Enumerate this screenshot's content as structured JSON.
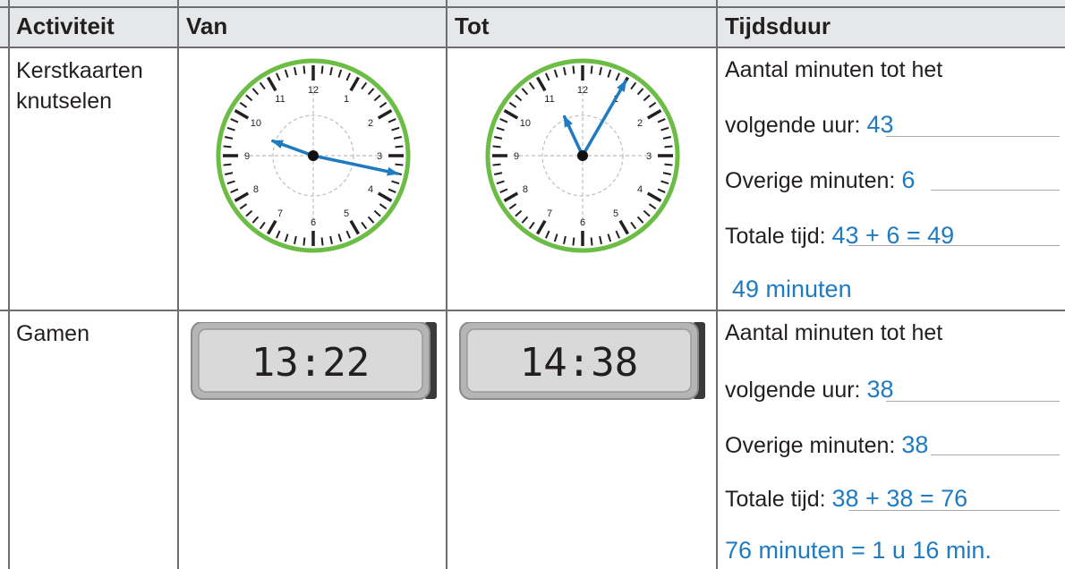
{
  "headers": [
    "Activiteit",
    "Van",
    "Tot",
    "Tijdsduur"
  ],
  "rows": [
    {
      "activity_line1": "Kerstkaarten",
      "activity_line2": "knutselen",
      "van": {
        "type": "analog",
        "hour_hand_angle": 290,
        "minute_hand_angle": 102
      },
      "tot": {
        "type": "analog",
        "hour_hand_angle": 335,
        "minute_hand_angle": 30
      },
      "duur": {
        "line1": "Aantal minuten tot het",
        "line2_label": "volgende uur: ",
        "line2_value": "43",
        "line3_label": "Overige minuten: ",
        "line3_value": "6",
        "line4_label": "Totale tijd: ",
        "line4_value": "43 + 6 = 49",
        "line5_value": "49 minuten"
      }
    },
    {
      "activity_line1": "Gamen",
      "van": {
        "type": "digital",
        "time": "13:22"
      },
      "tot": {
        "type": "digital",
        "time": "14:38"
      },
      "duur": {
        "line1": "Aantal minuten tot het",
        "line2_label": "volgende uur: ",
        "line2_value": "38",
        "line3_label": "Overige minuten: ",
        "line3_value": "38",
        "line4_label": "Totale tijd: ",
        "line4_value": "38 + 38 = 76",
        "line5_value": "76 minuten = 1 u 16 min."
      }
    }
  ],
  "colors": {
    "clock_ring": "#6cbd45",
    "hands": "#1f7bc1",
    "answers": "#1f7bc1",
    "header_bg": "#e6e7e8",
    "lcd_bg": "#d9d9d9"
  }
}
